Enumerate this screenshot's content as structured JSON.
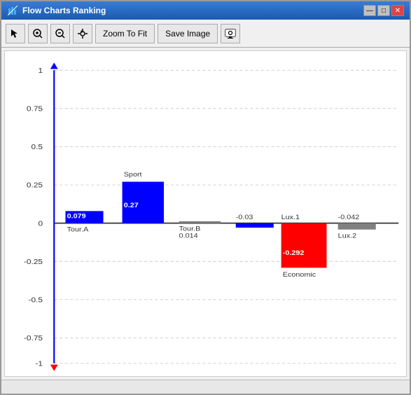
{
  "window": {
    "title": "Flow Charts Ranking",
    "titleIcon": "chart-icon"
  },
  "titleButtons": {
    "minimize": "—",
    "maximize": "□",
    "close": "✕"
  },
  "toolbar": {
    "tools": [
      {
        "name": "cursor-tool",
        "icon": "↖",
        "label": "Select"
      },
      {
        "name": "zoom-in-tool",
        "icon": "🔍+",
        "label": "Zoom In"
      },
      {
        "name": "zoom-out-tool",
        "icon": "🔍-",
        "label": "Zoom Out"
      },
      {
        "name": "pan-tool",
        "icon": "✋",
        "label": "Pan"
      }
    ],
    "buttons": [
      {
        "name": "zoom-to-fit-button",
        "label": "Zoom To Fit"
      },
      {
        "name": "save-image-button",
        "label": "Save Image"
      },
      {
        "name": "settings-button",
        "icon": "⚙"
      }
    ]
  },
  "chart": {
    "title": "Flow Charts Ranking",
    "yAxis": {
      "labels": [
        {
          "value": 1,
          "text": "1"
        },
        {
          "value": 0.75,
          "text": "0.75"
        },
        {
          "value": 0.5,
          "text": "0.5"
        },
        {
          "value": 0.25,
          "text": "0.25"
        },
        {
          "value": 0,
          "text": "0"
        },
        {
          "value": -0.25,
          "text": "-0.25"
        },
        {
          "value": -0.5,
          "text": "-0.5"
        },
        {
          "value": -0.75,
          "text": "-0.75"
        },
        {
          "value": -1,
          "text": "-1"
        }
      ]
    },
    "bars": [
      {
        "name": "Tour.A",
        "value": 0.079,
        "color": "blue",
        "labelBelow": true
      },
      {
        "name": "Sport",
        "value": 0.27,
        "color": "blue",
        "labelBelow": false
      },
      {
        "name": "Tour.B",
        "value": 0.014,
        "color": "gray",
        "labelBelow": true
      },
      {
        "name": "-0.03",
        "value": -0.03,
        "color": "blue",
        "labelBelow": false,
        "isNegative": true,
        "nameIsValue": true
      },
      {
        "name": "Lux.1",
        "value": -0.292,
        "color": "red",
        "labelBelow": false,
        "isNegative": true
      },
      {
        "name": "-0.042",
        "value": -0.042,
        "color": "gray",
        "labelBelow": false,
        "isNegative": true,
        "nameIsValue": true
      },
      {
        "name": "Lux.2",
        "value": -0.042,
        "color": "gray",
        "labelBelow": false,
        "isNegative": true
      }
    ]
  }
}
